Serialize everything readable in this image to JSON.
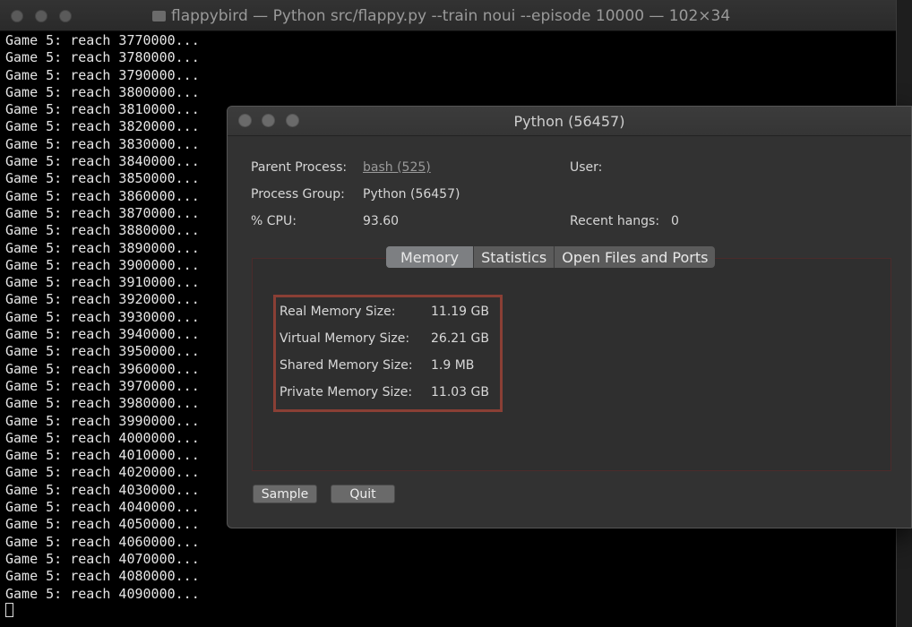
{
  "terminal": {
    "title": "flappybird — Python src/flappy.py --train noui --episode 10000 — 102×34",
    "lines": [
      "Game 5: reach 3770000...",
      "Game 5: reach 3780000...",
      "Game 5: reach 3790000...",
      "Game 5: reach 3800000...",
      "Game 5: reach 3810000...",
      "Game 5: reach 3820000...",
      "Game 5: reach 3830000...",
      "Game 5: reach 3840000...",
      "Game 5: reach 3850000...",
      "Game 5: reach 3860000...",
      "Game 5: reach 3870000...",
      "Game 5: reach 3880000...",
      "Game 5: reach 3890000...",
      "Game 5: reach 3900000...",
      "Game 5: reach 3910000...",
      "Game 5: reach 3920000...",
      "Game 5: reach 3930000...",
      "Game 5: reach 3940000...",
      "Game 5: reach 3950000...",
      "Game 5: reach 3960000...",
      "Game 5: reach 3970000...",
      "Game 5: reach 3980000...",
      "Game 5: reach 3990000...",
      "Game 5: reach 4000000...",
      "Game 5: reach 4010000...",
      "Game 5: reach 4020000...",
      "Game 5: reach 4030000...",
      "Game 5: reach 4040000...",
      "Game 5: reach 4050000...",
      "Game 5: reach 4060000...",
      "Game 5: reach 4070000...",
      "Game 5: reach 4080000...",
      "Game 5: reach 4090000..."
    ]
  },
  "dialog": {
    "title": "Python (56457)",
    "parent_process_label": "Parent Process:",
    "parent_process_value": "bash (525)",
    "user_label": "User:",
    "process_group_label": "Process Group:",
    "process_group_value": "Python (56457)",
    "cpu_label": "% CPU:",
    "cpu_value": "93.60",
    "recent_hangs_label": "Recent hangs:",
    "recent_hangs_value": "0",
    "tabs": [
      "Memory",
      "Statistics",
      "Open Files and Ports"
    ],
    "active_tab": "Memory",
    "memory": [
      {
        "label": "Real Memory Size:",
        "value": "11.19 GB"
      },
      {
        "label": "Virtual Memory Size:",
        "value": "26.21 GB"
      },
      {
        "label": "Shared Memory Size:",
        "value": "1.9 MB"
      },
      {
        "label": "Private Memory Size:",
        "value": "11.03 GB"
      }
    ],
    "sample_button": "Sample",
    "quit_button": "Quit"
  },
  "colors": {
    "highlight_border": "#8a3f35",
    "terminal_bg": "#000000",
    "dialog_bg": "#323232"
  }
}
